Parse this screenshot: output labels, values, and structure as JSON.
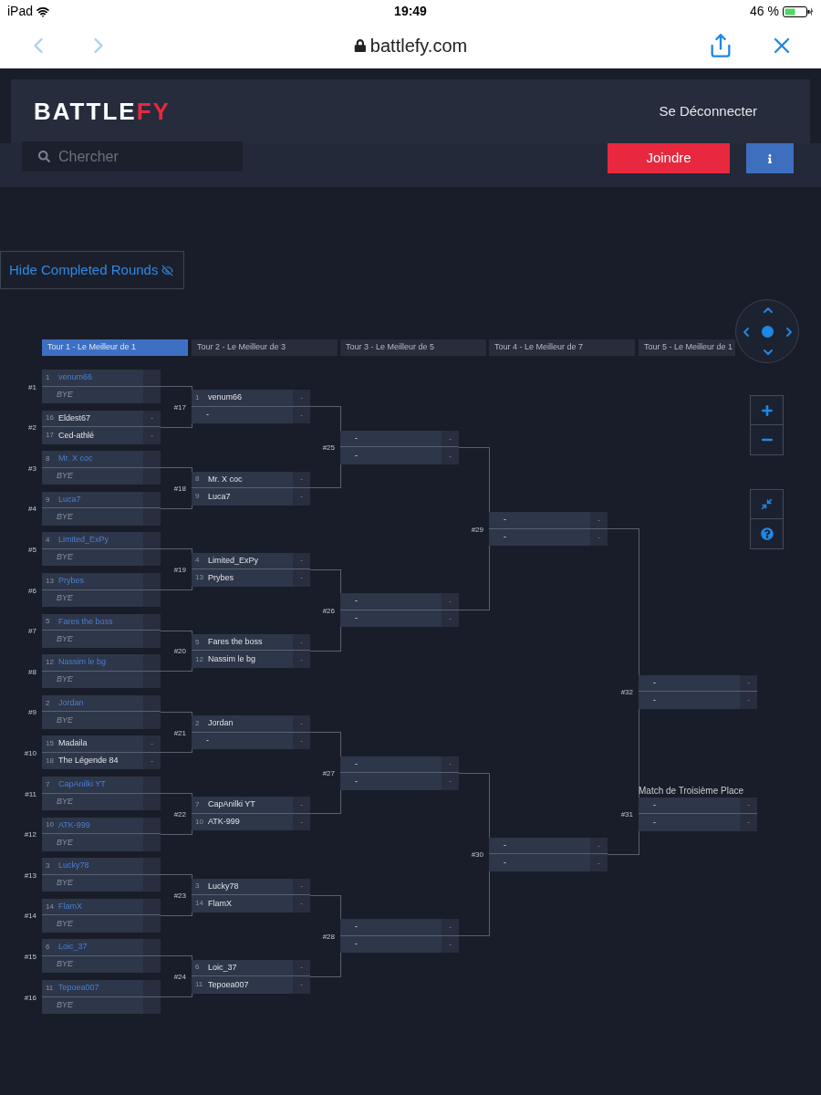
{
  "status_bar": {
    "device": "iPad",
    "time": "19:49",
    "battery": "46 %"
  },
  "browser": {
    "url": "battlefy.com"
  },
  "header": {
    "logo": {
      "text": "BATTLE",
      "accent_text": "FY"
    },
    "logout": "Se Déconnecter"
  },
  "toolbar": {
    "search": {
      "placeholder": "Chercher"
    },
    "join": "Joindre"
  },
  "hide_rounds": "Hide Completed Rounds",
  "rounds": [
    {
      "label": "Tour 1 - Le Meilleur de 1",
      "selected": true,
      "matches": [
        {
          "number": "#1",
          "completed": true,
          "slots": [
            {
              "kind": "team",
              "seed": "1",
              "name": "venum66"
            },
            {
              "kind": "bye",
              "name": "BYE"
            }
          ]
        },
        {
          "number": "#2",
          "completed": false,
          "slots": [
            {
              "kind": "team",
              "seed": "16",
              "name": "Eldest67",
              "score": "-"
            },
            {
              "kind": "team",
              "seed": "17",
              "name": "Ced-athlé",
              "score": "-"
            }
          ]
        },
        {
          "number": "#3",
          "completed": true,
          "slots": [
            {
              "kind": "team",
              "seed": "8",
              "name": "Mr. X coc"
            },
            {
              "kind": "bye",
              "name": "BYE"
            }
          ]
        },
        {
          "number": "#4",
          "completed": true,
          "slots": [
            {
              "kind": "team",
              "seed": "9",
              "name": "Luca7"
            },
            {
              "kind": "bye",
              "name": "BYE"
            }
          ]
        },
        {
          "number": "#5",
          "completed": true,
          "slots": [
            {
              "kind": "team",
              "seed": "4",
              "name": "Limited_ExPy"
            },
            {
              "kind": "bye",
              "name": "BYE"
            }
          ]
        },
        {
          "number": "#6",
          "completed": true,
          "slots": [
            {
              "kind": "team",
              "seed": "13",
              "name": "Prybes"
            },
            {
              "kind": "bye",
              "name": "BYE"
            }
          ]
        },
        {
          "number": "#7",
          "completed": true,
          "slots": [
            {
              "kind": "team",
              "seed": "5",
              "name": "Fares the boss"
            },
            {
              "kind": "bye",
              "name": "BYE"
            }
          ]
        },
        {
          "number": "#8",
          "completed": true,
          "slots": [
            {
              "kind": "team",
              "seed": "12",
              "name": "Nassim le bg"
            },
            {
              "kind": "bye",
              "name": "BYE"
            }
          ]
        },
        {
          "number": "#9",
          "completed": true,
          "slots": [
            {
              "kind": "team",
              "seed": "2",
              "name": "Jordan"
            },
            {
              "kind": "bye",
              "name": "BYE"
            }
          ]
        },
        {
          "number": "#10",
          "completed": false,
          "slots": [
            {
              "kind": "team",
              "seed": "15",
              "name": "Madaila",
              "score": "-"
            },
            {
              "kind": "team",
              "seed": "18",
              "name": "The Légende 84",
              "score": "-"
            }
          ]
        },
        {
          "number": "#11",
          "completed": true,
          "slots": [
            {
              "kind": "team",
              "seed": "7",
              "name": "CapAnilki YT"
            },
            {
              "kind": "bye",
              "name": "BYE"
            }
          ]
        },
        {
          "number": "#12",
          "completed": true,
          "slots": [
            {
              "kind": "team",
              "seed": "10",
              "name": "ATK-999"
            },
            {
              "kind": "bye",
              "name": "BYE"
            }
          ]
        },
        {
          "number": "#13",
          "completed": true,
          "slots": [
            {
              "kind": "team",
              "seed": "3",
              "name": "Lucky78"
            },
            {
              "kind": "bye",
              "name": "BYE"
            }
          ]
        },
        {
          "number": "#14",
          "completed": true,
          "slots": [
            {
              "kind": "team",
              "seed": "14",
              "name": "FlamX"
            },
            {
              "kind": "bye",
              "name": "BYE"
            }
          ]
        },
        {
          "number": "#15",
          "completed": true,
          "slots": [
            {
              "kind": "team",
              "seed": "6",
              "name": "Loic_37"
            },
            {
              "kind": "bye",
              "name": "BYE"
            }
          ]
        },
        {
          "number": "#16",
          "completed": true,
          "slots": [
            {
              "kind": "team",
              "seed": "11",
              "name": "Tepoea007"
            },
            {
              "kind": "bye",
              "name": "BYE"
            }
          ]
        }
      ]
    },
    {
      "label": "Tour 2 - Le Meilleur de 3",
      "selected": false,
      "matches": [
        {
          "number": "#17",
          "completed": false,
          "slots": [
            {
              "kind": "team",
              "seed": "1",
              "name": "venum66",
              "score": "-"
            },
            {
              "kind": "team",
              "name": "-",
              "score": "-"
            }
          ]
        },
        {
          "number": "#18",
          "completed": false,
          "slots": [
            {
              "kind": "team",
              "seed": "8",
              "name": "Mr. X coc",
              "score": "-"
            },
            {
              "kind": "team",
              "seed": "9",
              "name": "Luca7",
              "score": "-"
            }
          ]
        },
        {
          "number": "#19",
          "completed": false,
          "slots": [
            {
              "kind": "team",
              "seed": "4",
              "name": "Limited_ExPy",
              "score": "-"
            },
            {
              "kind": "team",
              "seed": "13",
              "name": "Prybes",
              "score": "-"
            }
          ]
        },
        {
          "number": "#20",
          "completed": false,
          "slots": [
            {
              "kind": "team",
              "seed": "5",
              "name": "Fares the boss",
              "score": "-"
            },
            {
              "kind": "team",
              "seed": "12",
              "name": "Nassim le bg",
              "score": "-"
            }
          ]
        },
        {
          "number": "#21",
          "completed": false,
          "slots": [
            {
              "kind": "team",
              "seed": "2",
              "name": "Jordan",
              "score": "-"
            },
            {
              "kind": "team",
              "name": "-",
              "score": "-"
            }
          ]
        },
        {
          "number": "#22",
          "completed": false,
          "slots": [
            {
              "kind": "team",
              "seed": "7",
              "name": "CapAnilki YT",
              "score": "-"
            },
            {
              "kind": "team",
              "seed": "10",
              "name": "ATK-999",
              "score": "-"
            }
          ]
        },
        {
          "number": "#23",
          "completed": false,
          "slots": [
            {
              "kind": "team",
              "seed": "3",
              "name": "Lucky78",
              "score": "-"
            },
            {
              "kind": "team",
              "seed": "14",
              "name": "FlamX",
              "score": "-"
            }
          ]
        },
        {
          "number": "#24",
          "completed": false,
          "slots": [
            {
              "kind": "team",
              "seed": "6",
              "name": "Loic_37",
              "score": "-"
            },
            {
              "kind": "team",
              "seed": "11",
              "name": "Tepoea007",
              "score": "-"
            }
          ]
        }
      ]
    },
    {
      "label": "Tour 3 - Le Meilleur de 5",
      "selected": false,
      "matches": [
        {
          "number": "#25",
          "completed": false,
          "slots": [
            {
              "kind": "team",
              "name": "-",
              "score": "-"
            },
            {
              "kind": "team",
              "name": "-",
              "score": "-"
            }
          ]
        },
        {
          "number": "#26",
          "completed": false,
          "slots": [
            {
              "kind": "team",
              "name": "-",
              "score": "-"
            },
            {
              "kind": "team",
              "name": "-",
              "score": "-"
            }
          ]
        },
        {
          "number": "#27",
          "completed": false,
          "slots": [
            {
              "kind": "team",
              "name": "-",
              "score": "-"
            },
            {
              "kind": "team",
              "name": "-",
              "score": "-"
            }
          ]
        },
        {
          "number": "#28",
          "completed": false,
          "slots": [
            {
              "kind": "team",
              "name": "-",
              "score": "-"
            },
            {
              "kind": "team",
              "name": "-",
              "score": "-"
            }
          ]
        }
      ]
    },
    {
      "label": "Tour 4 - Le Meilleur de 7",
      "selected": false,
      "matches": [
        {
          "number": "#29",
          "completed": false,
          "slots": [
            {
              "kind": "team",
              "name": "-",
              "score": "-"
            },
            {
              "kind": "team",
              "name": "-",
              "score": "-"
            }
          ]
        },
        {
          "number": "#30",
          "completed": false,
          "slots": [
            {
              "kind": "team",
              "name": "-",
              "score": "-"
            },
            {
              "kind": "team",
              "name": "-",
              "score": "-"
            }
          ]
        }
      ]
    },
    {
      "label": "Tour 5 - Le Meilleur de 1",
      "selected": false,
      "matches": [
        {
          "number": "#32",
          "completed": false,
          "kind": "final",
          "slots": [
            {
              "kind": "team",
              "name": "-",
              "score": "-"
            },
            {
              "kind": "team",
              "name": "-",
              "score": "-"
            }
          ]
        },
        {
          "number": "#31",
          "completed": false,
          "kind": "third_place",
          "title": "Match de Troisième Place",
          "slots": [
            {
              "kind": "team",
              "name": "-",
              "score": "-"
            },
            {
              "kind": "team",
              "name": "-",
              "score": "-"
            }
          ]
        }
      ]
    }
  ]
}
